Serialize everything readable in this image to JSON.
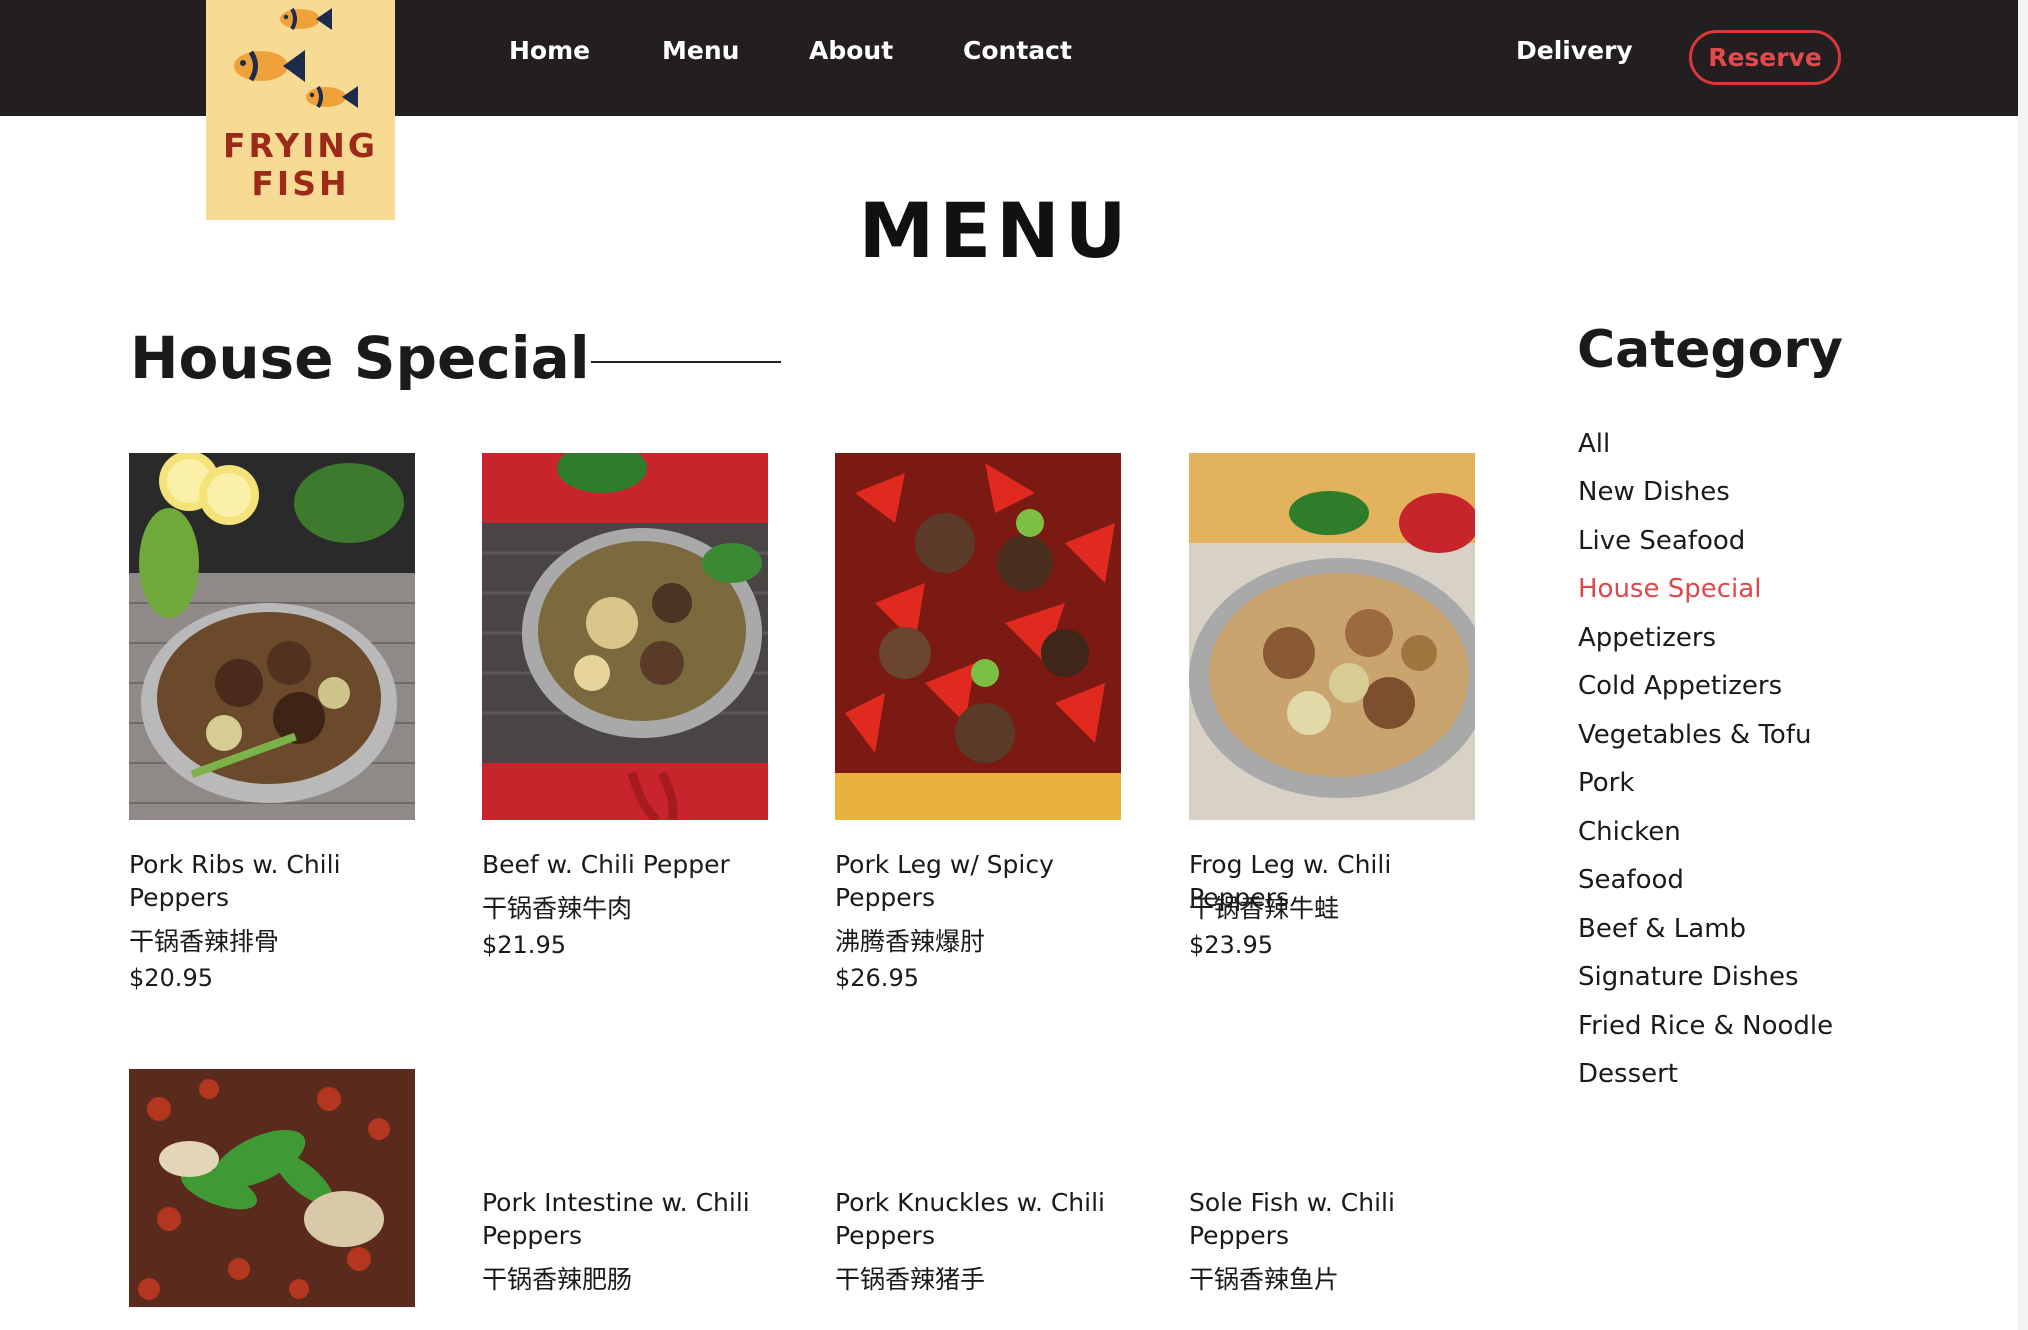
{
  "brand": {
    "logo_line1": "FRYING",
    "logo_line2": "FISH",
    "logo_bg": "#f7db94",
    "logo_text_color": "#9b2a18",
    "fish_body_color": "#f0a23a",
    "fish_tail_color": "#1d2b4c"
  },
  "nav": {
    "home": "Home",
    "menu": "Menu",
    "about": "About",
    "contact": "Contact",
    "delivery": "Delivery",
    "reserve": "Reserve",
    "bar_color": "#231f20",
    "reserve_color": "#d8383b"
  },
  "page": {
    "title": "MENU",
    "section_title": "House Special"
  },
  "sidebar": {
    "title": "Category",
    "active_color": "#e0474b",
    "items": [
      {
        "label": "All",
        "active": false
      },
      {
        "label": "New Dishes",
        "active": false
      },
      {
        "label": "Live Seafood",
        "active": false
      },
      {
        "label": "House Special",
        "active": true
      },
      {
        "label": "Appetizers",
        "active": false
      },
      {
        "label": "Cold Appetizers",
        "active": false
      },
      {
        "label": "Vegetables & Tofu",
        "active": false
      },
      {
        "label": "Pork",
        "active": false
      },
      {
        "label": "Chicken",
        "active": false
      },
      {
        "label": "Seafood",
        "active": false
      },
      {
        "label": "Beef & Lamb",
        "active": false
      },
      {
        "label": "Signature Dishes",
        "active": false
      },
      {
        "label": "Fried Rice & Noodle",
        "active": false
      },
      {
        "label": "Dessert",
        "active": false
      }
    ]
  },
  "dishes": [
    {
      "name": "Pork Ribs w. Chili Peppers",
      "chinese": "干锅香辣排骨",
      "price": "$20.95",
      "photo": "pork-ribs-photo"
    },
    {
      "name": "Beef w. Chili Pepper",
      "chinese": "干锅香辣牛肉",
      "price": "$21.95",
      "photo": "beef-photo"
    },
    {
      "name": "Pork Leg w/ Spicy Peppers",
      "chinese": "沸腾香辣爆肘",
      "price": "$26.95",
      "photo": "pork-leg-photo"
    },
    {
      "name": "Frog Leg w. Chili Peppers",
      "chinese": "干锅香辣牛蛙",
      "price": "$23.95",
      "photo": "frog-leg-photo"
    },
    {
      "name": "",
      "chinese": "",
      "price": "",
      "photo": "chili-dish-photo"
    },
    {
      "name": "Pork Intestine w. Chili Peppers",
      "chinese": "干锅香辣肥肠",
      "price": "",
      "photo": ""
    },
    {
      "name": "Pork Knuckles w. Chili Peppers",
      "chinese": "干锅香辣猪手",
      "price": "",
      "photo": ""
    },
    {
      "name": "Sole Fish w. Chili Peppers",
      "chinese": "干锅香辣鱼片",
      "price": "",
      "photo": ""
    }
  ]
}
